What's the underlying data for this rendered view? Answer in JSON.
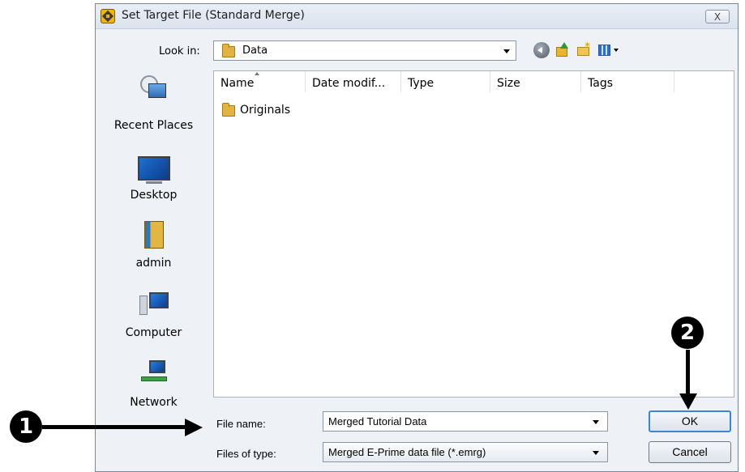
{
  "window": {
    "title": "Set Target File (Standard Merge)",
    "close_glyph": "X"
  },
  "toolbar": {
    "look_in_label": "Look in:",
    "look_in_value": "Data",
    "icons": [
      "back-icon",
      "up-folder-icon",
      "new-folder-icon",
      "views-menu-icon"
    ]
  },
  "places": [
    {
      "label": "Recent Places",
      "icon": "recent-places-icon"
    },
    {
      "label": "Desktop",
      "icon": "desktop-icon"
    },
    {
      "label": "admin",
      "icon": "user-folder-icon"
    },
    {
      "label": "Computer",
      "icon": "computer-icon"
    },
    {
      "label": "Network",
      "icon": "network-icon"
    }
  ],
  "file_list": {
    "columns": [
      "Name",
      "Date modif...",
      "Type",
      "Size",
      "Tags"
    ],
    "sorted_by": "Name",
    "items": [
      {
        "name": "Originals",
        "kind": "folder"
      }
    ]
  },
  "form": {
    "file_name_label": "File name:",
    "file_name_value": "Merged Tutorial Data",
    "file_type_label": "Files of type:",
    "file_type_value": "Merged E-Prime data file (*.emrg)"
  },
  "buttons": {
    "ok": "OK",
    "cancel": "Cancel"
  },
  "callouts": [
    "1",
    "2"
  ],
  "colors": {
    "dialog_bg": "#eef1f6",
    "ok_focus_border": "#3a86d4",
    "callout": "#000000"
  }
}
